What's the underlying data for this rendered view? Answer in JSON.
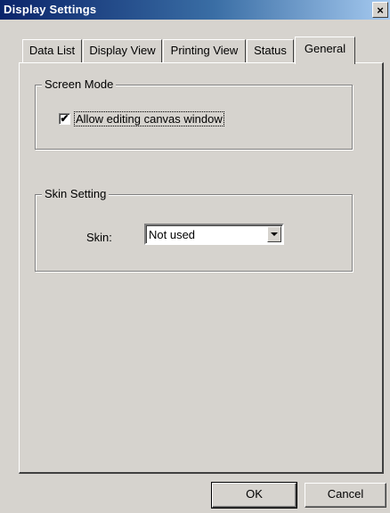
{
  "window": {
    "title": "Display Settings",
    "close_glyph": "×",
    "close_icon": "close-icon"
  },
  "tabs": [
    {
      "label": "Data List",
      "active": false
    },
    {
      "label": "Display View",
      "active": false
    },
    {
      "label": "Printing View",
      "active": false
    },
    {
      "label": "Status",
      "active": false
    },
    {
      "label": "General",
      "active": true
    }
  ],
  "screen_mode": {
    "group_label": "Screen Mode",
    "allow_editing": {
      "label": "Allow editing canvas window",
      "checked": true,
      "check_glyph": "✔"
    }
  },
  "skin_setting": {
    "group_label": "Skin Setting",
    "skin_label": "Skin:",
    "skin_value": "Not used"
  },
  "buttons": {
    "ok": "OK",
    "cancel": "Cancel"
  },
  "colors": {
    "dialog_bg": "#d6d3ce",
    "title_bar": "#0a246a"
  }
}
